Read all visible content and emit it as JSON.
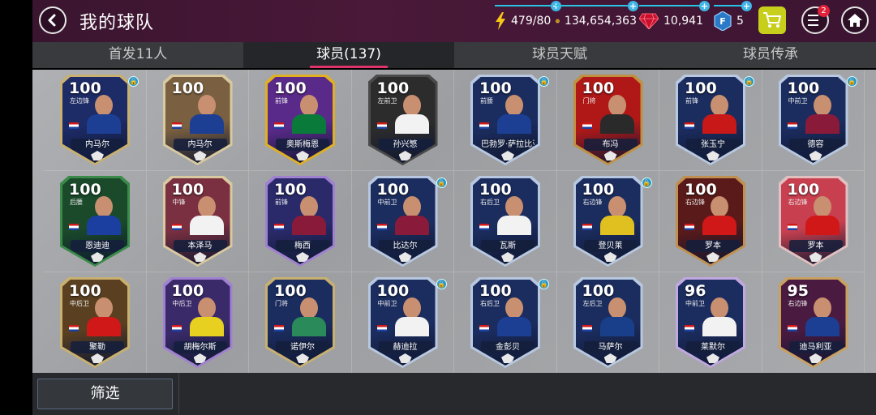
{
  "header": {
    "title": "我的球队",
    "energy": "479/80",
    "coins": "134,654,363",
    "gems": "10,941",
    "fifa_points": "5",
    "notification_count": "2"
  },
  "tabs": [
    {
      "label": "首发11人"
    },
    {
      "label": "球员(137)"
    },
    {
      "label": "球员天赋"
    },
    {
      "label": "球员传承"
    }
  ],
  "players": [
    {
      "name": "内马尔",
      "rating": "100",
      "pos": "左边锋",
      "frame": "#c8b070",
      "bg": "#1d2b66",
      "jersey": "#1c3f94",
      "locked": true
    },
    {
      "name": "内马尔",
      "rating": "100",
      "pos": "",
      "frame": "#d9c9a0",
      "bg": "#7a6040",
      "jersey": "#1c3f94",
      "locked": false
    },
    {
      "name": "奥斯梅恩",
      "rating": "100",
      "pos": "前锋",
      "frame": "#e0b020",
      "bg": "#5a2a8a",
      "jersey": "#0a7a3a",
      "locked": false
    },
    {
      "name": "孙兴慜",
      "rating": "100",
      "pos": "左前卫",
      "frame": "#4a4a4a",
      "bg": "#2c2c2c",
      "jersey": "#f2f2f2",
      "locked": false
    },
    {
      "name": "巴勃罗·萨拉比亚",
      "rating": "100",
      "pos": "前腰",
      "frame": "#b8c8e0",
      "bg": "#1b2c5e",
      "jersey": "#1c3f94",
      "locked": true
    },
    {
      "name": "布冯",
      "rating": "100",
      "pos": "门将",
      "frame": "#c09040",
      "bg": "#b01818",
      "jersey": "#2a2a2a",
      "locked": false
    },
    {
      "name": "张玉宁",
      "rating": "100",
      "pos": "前锋",
      "frame": "#b8c8e0",
      "bg": "#1b2c5e",
      "jersey": "#c81818",
      "locked": true
    },
    {
      "name": "德容",
      "rating": "100",
      "pos": "中前卫",
      "frame": "#b8c8e0",
      "bg": "#1b2c5e",
      "jersey": "#8a1a3a",
      "locked": true
    },
    {
      "name": "恩迪迪",
      "rating": "100",
      "pos": "后腰",
      "frame": "#3a8a4a",
      "bg": "#1a4a2a",
      "jersey": "#1a3fa0",
      "locked": false
    },
    {
      "name": "本泽马",
      "rating": "100",
      "pos": "中锋",
      "frame": "#d9c9a0",
      "bg": "#7a3040",
      "jersey": "#f2f2f2",
      "locked": false
    },
    {
      "name": "梅西",
      "rating": "100",
      "pos": "前锋",
      "frame": "#a080d0",
      "bg": "#2a2a6a",
      "jersey": "#8a1a3a",
      "locked": false
    },
    {
      "name": "比达尔",
      "rating": "100",
      "pos": "中前卫",
      "frame": "#b8c8e0",
      "bg": "#1b2c5e",
      "jersey": "#8a1a3a",
      "locked": true
    },
    {
      "name": "瓦斯",
      "rating": "100",
      "pos": "右后卫",
      "frame": "#b8c8e0",
      "bg": "#1b2c5e",
      "jersey": "#f2f2f2",
      "locked": false
    },
    {
      "name": "登贝莱",
      "rating": "100",
      "pos": "右边锋",
      "frame": "#b8c8e0",
      "bg": "#1b2c5e",
      "jersey": "#e0c020",
      "locked": true
    },
    {
      "name": "罗本",
      "rating": "100",
      "pos": "右边锋",
      "frame": "#c09050",
      "bg": "#5a1a1a",
      "jersey": "#d01818",
      "locked": false
    },
    {
      "name": "罗本",
      "rating": "100",
      "pos": "右边锋",
      "frame": "#e0c0c0",
      "bg": "#c84050",
      "jersey": "#d01818",
      "locked": false
    },
    {
      "name": "聚勒",
      "rating": "100",
      "pos": "中后卫",
      "frame": "#c8b070",
      "bg": "#5a4020",
      "jersey": "#d01818",
      "locked": false
    },
    {
      "name": "胡梅尔斯",
      "rating": "100",
      "pos": "中后卫",
      "frame": "#a080d0",
      "bg": "#3a2a6a",
      "jersey": "#e8d020",
      "locked": false
    },
    {
      "name": "诺伊尔",
      "rating": "100",
      "pos": "门将",
      "frame": "#c8b070",
      "bg": "#1b2c5e",
      "jersey": "#2a8a5a",
      "locked": false
    },
    {
      "name": "赫迪拉",
      "rating": "100",
      "pos": "中前卫",
      "frame": "#b8c8e0",
      "bg": "#1b2c5e",
      "jersey": "#f2f2f2",
      "locked": true
    },
    {
      "name": "金彭贝",
      "rating": "100",
      "pos": "右后卫",
      "frame": "#b8c8e0",
      "bg": "#1b2c5e",
      "jersey": "#1c3f94",
      "locked": true
    },
    {
      "name": "马萨尔",
      "rating": "100",
      "pos": "左后卫",
      "frame": "#b8c8e0",
      "bg": "#1b2c5e",
      "jersey": "#1a3f8a",
      "locked": false
    },
    {
      "name": "莱默尔",
      "rating": "96",
      "pos": "中前卫",
      "frame": "#c0a8e0",
      "bg": "#1b2c5e",
      "jersey": "#f2f2f2",
      "locked": false
    },
    {
      "name": "迪马利亚",
      "rating": "95",
      "pos": "右边锋",
      "frame": "#c8a060",
      "bg": "#4a1a40",
      "jersey": "#1c3f94",
      "locked": false
    }
  ],
  "footer": {
    "filter_label": "筛选"
  },
  "icons": {
    "back": "chevron-left-icon",
    "energy": "lightning-icon",
    "coin": "coin-icon",
    "gem": "ruby-icon",
    "points": "fifa-points-icon",
    "cart": "cart-icon",
    "menu": "menu-icon",
    "home": "home-icon"
  }
}
